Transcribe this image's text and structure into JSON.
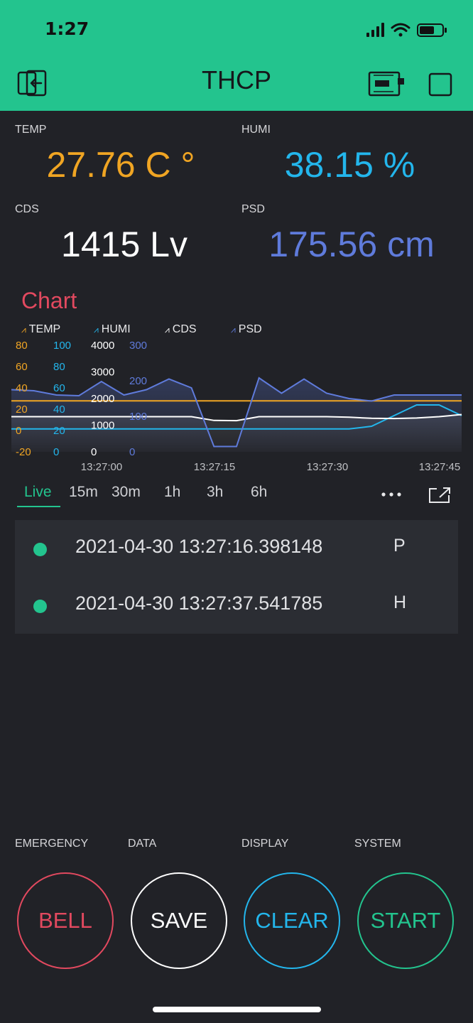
{
  "status_bar": {
    "time": "1:27"
  },
  "header": {
    "title": "THCP",
    "back_icon": "exit-icon",
    "device_icon": "device-board-icon",
    "frame_icon": "square-icon"
  },
  "values": {
    "temp": {
      "label": "TEMP",
      "value": "27.76 C °",
      "color": "#f0a523"
    },
    "humi": {
      "label": "HUMI",
      "value": "38.15 %",
      "color": "#23b6ec"
    },
    "cds": {
      "label": "CDS",
      "value": "1415 Lv",
      "color": "#ffffff"
    },
    "psd": {
      "label": "PSD",
      "value": "175.56 cm",
      "color": "#5f7bdb"
    }
  },
  "chart": {
    "title": "Chart",
    "legend": [
      "TEMP",
      "HUMI",
      "CDS",
      "PSD"
    ],
    "axes": {
      "temp": [
        "80",
        "60",
        "40",
        "20",
        "0",
        "-20"
      ],
      "humi": [
        "100",
        "80",
        "60",
        "40",
        "20",
        "0"
      ],
      "cds": [
        "4000",
        "3000",
        "2000",
        "1000",
        "0"
      ],
      "psd": [
        "300",
        "200",
        "100",
        "0"
      ]
    },
    "x_ticks": [
      "13:27:00",
      "13:27:15",
      "13:27:30",
      "13:27:45"
    ]
  },
  "chart_data": {
    "type": "line",
    "title": "Chart",
    "x": [
      "13:26:52",
      "13:26:55",
      "13:26:57",
      "13:27:00",
      "13:27:02",
      "13:27:05",
      "13:27:08",
      "13:27:11",
      "13:27:14",
      "13:27:17",
      "13:27:19",
      "13:27:22",
      "13:27:24",
      "13:27:27",
      "13:27:30",
      "13:27:33",
      "13:27:36",
      "13:27:39",
      "13:27:42",
      "13:27:45",
      "13:27:48"
    ],
    "series": [
      {
        "name": "TEMP",
        "axis": "temp",
        "ylim": [
          -20,
          80
        ],
        "color": "#f0a523",
        "values": [
          27.8,
          27.8,
          27.8,
          27.8,
          27.8,
          27.8,
          27.8,
          27.8,
          27.8,
          27.8,
          27.8,
          27.8,
          27.8,
          27.8,
          27.8,
          27.8,
          27.8,
          27.8,
          27.8,
          27.8,
          27.8
        ]
      },
      {
        "name": "HUMI",
        "axis": "humi",
        "ylim": [
          0,
          100
        ],
        "color": "#23b6ec",
        "values": [
          21.5,
          21.5,
          21.5,
          21.5,
          21.5,
          21.5,
          21.5,
          21.5,
          21.5,
          21.5,
          21.5,
          21.5,
          21.5,
          21.5,
          21.5,
          21.5,
          24,
          34,
          44,
          44,
          34
        ]
      },
      {
        "name": "CDS",
        "axis": "cds",
        "ylim": [
          0,
          4000
        ],
        "color": "#ffffff",
        "values": [
          1320,
          1320,
          1320,
          1320,
          1320,
          1320,
          1320,
          1320,
          1320,
          1180,
          1170,
          1320,
          1320,
          1320,
          1320,
          1300,
          1260,
          1250,
          1270,
          1320,
          1400
        ]
      },
      {
        "name": "PSD",
        "axis": "psd",
        "ylim": [
          0,
          300
        ],
        "color": "#5f7bdb",
        "values": [
          175,
          172,
          160,
          158,
          198,
          160,
          175,
          205,
          180,
          15,
          15,
          208,
          165,
          205,
          165,
          150,
          143,
          160,
          160,
          160,
          160
        ]
      }
    ]
  },
  "time_tabs": [
    "Live",
    "15m",
    "30m",
    "1h",
    "3h",
    "6h"
  ],
  "menu_icons": {
    "more": "more-dots-icon",
    "expand": "external-link-icon"
  },
  "table_rows": [
    {
      "name": "2021-04-30 13:27:16.398148",
      "value": "P"
    },
    {
      "name": "2021-04-30 13:27:37.541785",
      "value": "H"
    }
  ],
  "buttons": [
    {
      "label": "EMERGENCY",
      "text": "BELL",
      "color": "#e2495f"
    },
    {
      "label": "DATA",
      "text": "SAVE",
      "color": "#ffffff"
    },
    {
      "label": "DISPLAY",
      "text": "CLEAR",
      "color": "#23b6ec"
    },
    {
      "label": "SYSTEM",
      "text": "START",
      "color": "#23c48e"
    }
  ]
}
